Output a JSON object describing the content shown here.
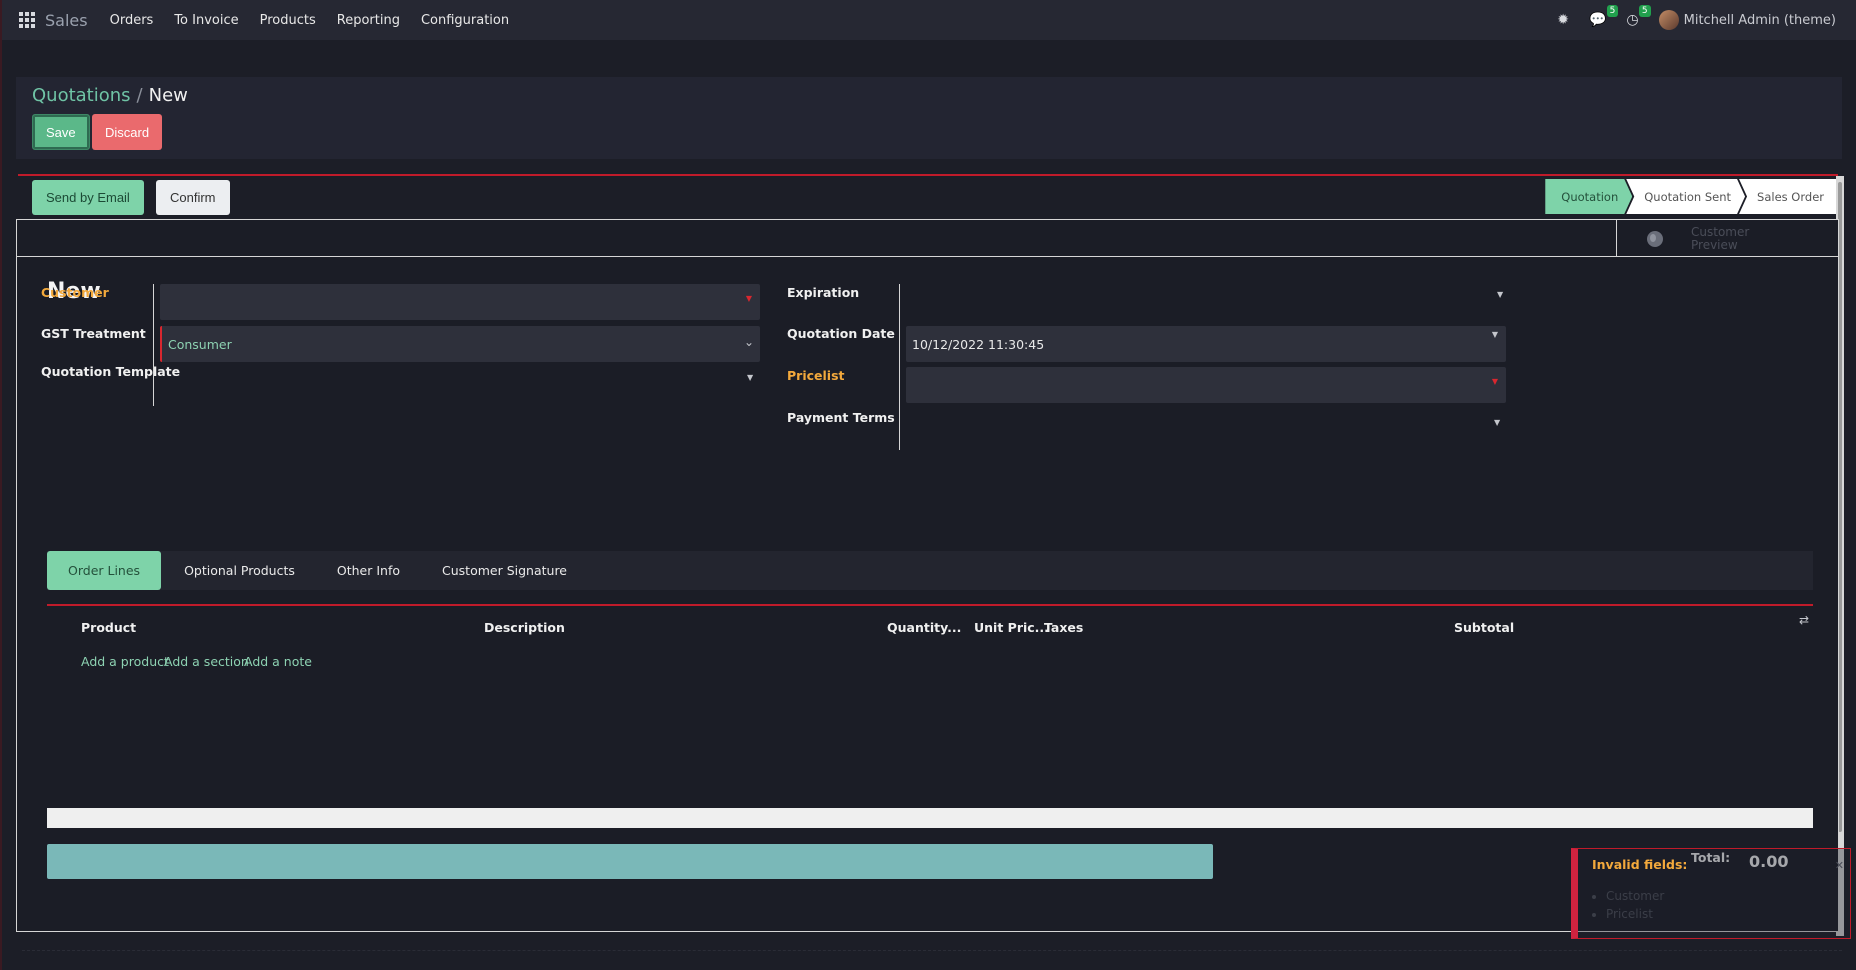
{
  "navbar": {
    "brand": "Sales",
    "menu": [
      "Orders",
      "To Invoice",
      "Products",
      "Reporting",
      "Configuration"
    ],
    "messages_count": "5",
    "activities_count": "5",
    "user_name": "Mitchell Admin (theme)"
  },
  "breadcrumb": {
    "parent": "Quotations",
    "separator": "/",
    "current": "New"
  },
  "buttons": {
    "save": "Save",
    "discard": "Discard",
    "send_email": "Send by Email",
    "confirm": "Confirm"
  },
  "statusbar": {
    "steps": [
      "Quotation",
      "Quotation Sent",
      "Sales Order"
    ],
    "active": "Quotation"
  },
  "smart_button": {
    "label": "Customer Preview"
  },
  "form": {
    "title": "New",
    "left": {
      "customer_label": "Customer",
      "customer_value": "",
      "gst_label": "GST Treatment",
      "gst_value": "Consumer",
      "template_label": "Quotation Template",
      "template_value": ""
    },
    "right": {
      "expiration_label": "Expiration",
      "expiration_value": "",
      "date_label": "Quotation Date",
      "date_value": "10/12/2022 11:30:45",
      "pricelist_label": "Pricelist",
      "pricelist_value": "",
      "payment_label": "Payment Terms",
      "payment_value": ""
    }
  },
  "tabs": [
    "Order Lines",
    "Optional Products",
    "Other Info",
    "Customer Signature"
  ],
  "order_lines": {
    "columns": [
      "Product",
      "Description",
      "Quantity...",
      "Unit Pric...",
      "Taxes",
      "Subtotal"
    ],
    "links": [
      "Add a product",
      "Add a section",
      "Add a note"
    ]
  },
  "totals": {
    "label": "Total:",
    "value": "0.00"
  },
  "toast": {
    "title": "Invalid fields:",
    "items": [
      "Customer",
      "Pricelist"
    ]
  },
  "colors": {
    "accent": "#7ed3a9",
    "required": "#f3a93c",
    "danger": "#d8272f",
    "background": "#1c1e27"
  }
}
